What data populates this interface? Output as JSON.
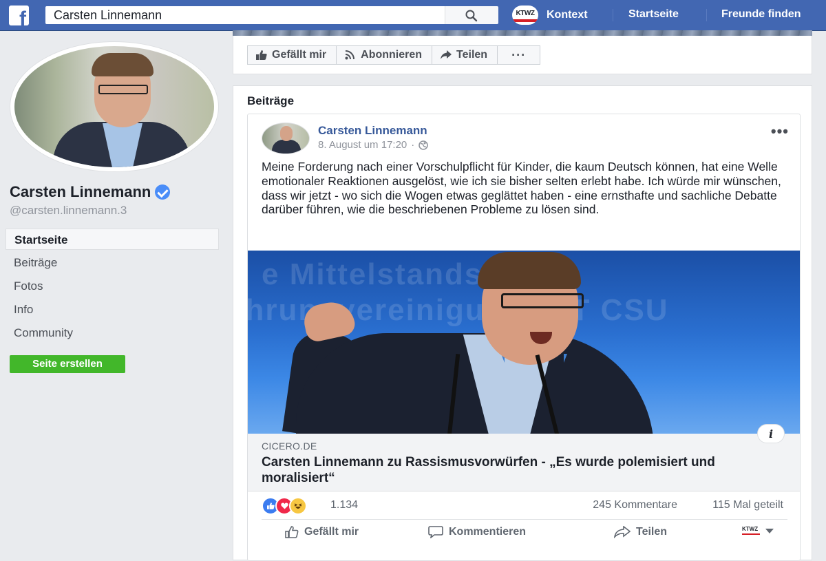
{
  "topbar": {
    "logo": "f",
    "search_value": "Carsten Linnemann",
    "profile_badge": "KTWZ",
    "profile_label": "Kontext",
    "home_label": "Startseite",
    "friends_label": "Freunde finden"
  },
  "sidebar": {
    "page_name": "Carsten Linnemann",
    "handle": "@carsten.linnemann.3",
    "items": [
      {
        "label": "Startseite"
      },
      {
        "label": "Beiträge"
      },
      {
        "label": "Fotos"
      },
      {
        "label": "Info"
      },
      {
        "label": "Community"
      }
    ],
    "create_page_label": "Seite erstellen"
  },
  "page_actions": {
    "like_label": "Gefällt mir",
    "follow_label": "Abonnieren",
    "share_label": "Teilen",
    "more_label": "···"
  },
  "posts_section": {
    "heading": "Beiträge"
  },
  "post": {
    "author": "Carsten Linnemann",
    "timestamp": "8. August um 17:20",
    "meta_separator": "·",
    "options": "•••",
    "text": "Meine Forderung nach einer Vorschulpflicht für Kinder, die kaum Deutsch können, hat eine Welle emotionaler Reaktionen ausgelöst, wie ich sie bisher selten erlebt habe. Ich würde mir wünschen, dass wir jetzt - wo sich die Wogen etwas geglättet haben - eine ernsthafte und sachliche Debatte darüber führen, wie die beschriebenen Probleme zu lösen sind.",
    "link": {
      "domain": "CICERO.DE",
      "title": "Carsten Linnemann zu Rassismusvorwürfen - „Es wurde polemisiert und moralisiert“",
      "info": "i"
    },
    "reactions_count": "1.134",
    "comments_count": "245 Kommentare",
    "shares_count": "115 Mal geteilt",
    "actions": {
      "like_label": "Gefällt mir",
      "comment_label": "Kommentieren",
      "share_label": "Teilen",
      "page_badge": "KTWZ"
    }
  },
  "colors": {
    "facebook_blue": "#4267b2",
    "link_blue": "#365899",
    "create_green": "#42b72a",
    "verified_blue": "#4a8df8"
  },
  "icons": [
    "facebook-logo",
    "search-icon",
    "verified-badge-icon",
    "thumbs-up-icon",
    "rss-icon",
    "share-arrow-icon",
    "globe-icon",
    "comment-icon",
    "like-reaction-icon",
    "love-reaction-icon",
    "haha-reaction-icon",
    "chevron-down-icon"
  ]
}
